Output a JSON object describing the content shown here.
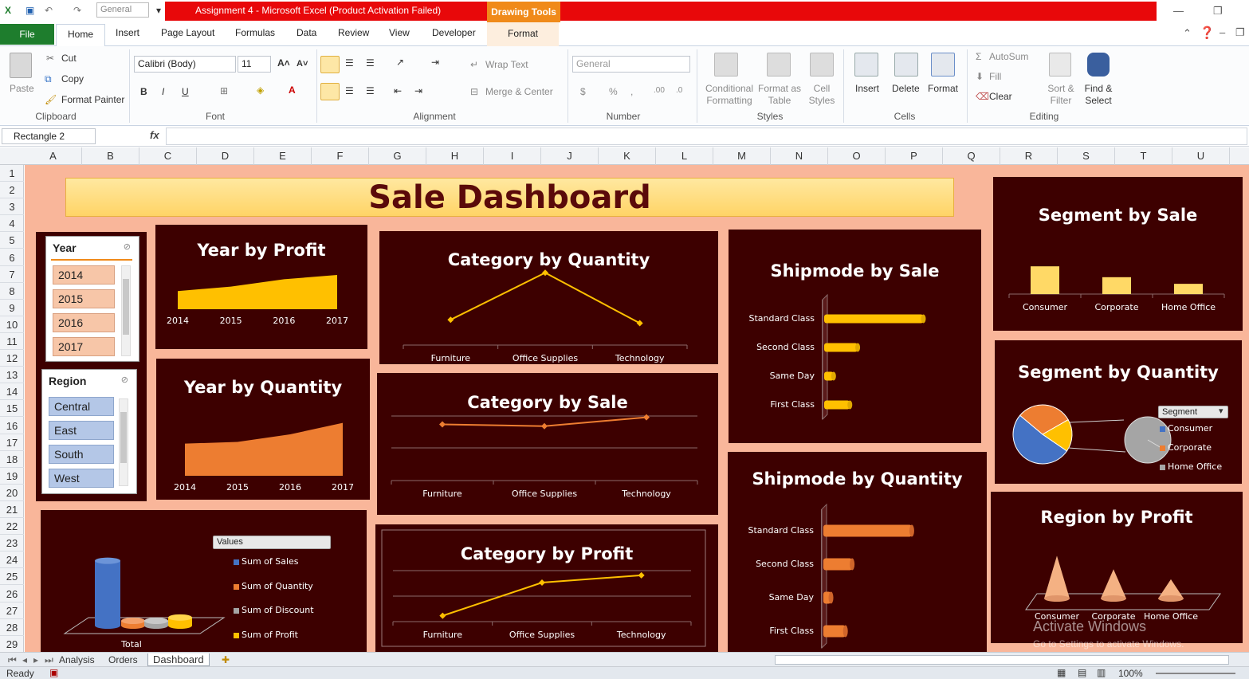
{
  "window": {
    "title": "Assignment 4 - Microsoft Excel (Product Activation Failed)",
    "contextual_tab": "Drawing Tools",
    "qat_combo": "General"
  },
  "tabs": [
    "Home",
    "Insert",
    "Page Layout",
    "Formulas",
    "Data",
    "Review",
    "View",
    "Developer",
    "Format"
  ],
  "file_tab": "File",
  "ribbon": {
    "clipboard": {
      "paste": "Paste",
      "cut": "Cut",
      "copy": "Copy",
      "format_painter": "Format Painter",
      "group": "Clipboard"
    },
    "font": {
      "name": "Calibri (Body)",
      "size": "11",
      "group": "Font"
    },
    "alignment": {
      "wrap": "Wrap Text",
      "merge": "Merge & Center",
      "group": "Alignment"
    },
    "number": {
      "format": "General",
      "group": "Number"
    },
    "styles": {
      "conditional": "Conditional Formatting",
      "format_table": "Format as Table",
      "cell_styles": "Cell Styles",
      "group": "Styles"
    },
    "cells": {
      "insert": "Insert",
      "delete": "Delete",
      "format": "Format",
      "group": "Cells"
    },
    "editing": {
      "autosum": "AutoSum",
      "fill": "Fill",
      "clear": "Clear",
      "sort": "Sort & Filter",
      "find": "Find & Select",
      "group": "Editing"
    }
  },
  "formula_bar": {
    "name_box": "Rectangle 2",
    "fx": "fx",
    "value": ""
  },
  "columns": [
    "A",
    "B",
    "C",
    "D",
    "E",
    "F",
    "G",
    "H",
    "I",
    "J",
    "K",
    "L",
    "M",
    "N",
    "O",
    "P",
    "Q",
    "R",
    "S",
    "T",
    "U"
  ],
  "rows": [
    "1",
    "2",
    "3",
    "4",
    "5",
    "6",
    "7",
    "8",
    "9",
    "10",
    "11",
    "12",
    "13",
    "14",
    "15",
    "16",
    "17",
    "18",
    "19",
    "20",
    "21",
    "22",
    "23",
    "24",
    "25",
    "26",
    "27",
    "28",
    "29"
  ],
  "dashboard": {
    "title": "Sale Dashboard",
    "slicers": {
      "year": {
        "header": "Year",
        "items": [
          "2014",
          "2015",
          "2016",
          "2017"
        ]
      },
      "region": {
        "header": "Region",
        "items": [
          "Central",
          "East",
          "South",
          "West"
        ]
      }
    },
    "values_legend": {
      "header": "Values",
      "items": [
        "Sum of Sales",
        "Sum of Quantity",
        "Sum of Discount",
        "Sum of Profit"
      ],
      "category": "Total"
    },
    "segment_legend": {
      "header": "Segment",
      "items": [
        "Consumer",
        "Corporate",
        "Home Office"
      ]
    }
  },
  "chart_data": [
    {
      "id": "year_by_profit",
      "type": "area",
      "title": "Year by Profit",
      "categories": [
        "2014",
        "2015",
        "2016",
        "2017"
      ],
      "values": [
        49500,
        61600,
        81800,
        93400
      ],
      "ylim": [
        0,
        100000
      ],
      "color": "#ffc000"
    },
    {
      "id": "year_by_quantity",
      "type": "area",
      "title": "Year by Quantity",
      "categories": [
        "2014",
        "2015",
        "2016",
        "2017"
      ],
      "values": [
        7600,
        8000,
        9800,
        12500
      ],
      "ylim": [
        0,
        13000
      ],
      "color": "#ed7d31"
    },
    {
      "id": "category_by_quantity",
      "type": "line",
      "title": "Category by Quantity",
      "categories": [
        "Furniture",
        "Office Supplies",
        "Technology"
      ],
      "values": [
        8028,
        22906,
        6939
      ],
      "ylim": [
        0,
        26000
      ],
      "color": "#ffc000"
    },
    {
      "id": "category_by_sale",
      "type": "line",
      "title": "Category by Sale",
      "categories": [
        "Furniture",
        "Office Supplies",
        "Technology"
      ],
      "values": [
        742000,
        719000,
        836000
      ],
      "ylim": [
        0,
        1000000
      ],
      "color": "#ed7d31"
    },
    {
      "id": "category_by_profit",
      "type": "line",
      "title": "Category by Profit",
      "categories": [
        "Furniture",
        "Office Supplies",
        "Technology"
      ],
      "values": [
        18451,
        122491,
        145455
      ],
      "ylim": [
        0,
        180000
      ],
      "color": "#ffc000"
    },
    {
      "id": "shipmode_by_sale",
      "type": "bar",
      "title": "Shipmode by Sale",
      "categories": [
        "Standard Class",
        "Second Class",
        "Same Day",
        "First Class"
      ],
      "values": [
        1358000,
        459000,
        129000,
        352000
      ],
      "xlim": [
        0,
        1800000
      ],
      "color": "#ffc000"
    },
    {
      "id": "shipmode_by_quantity",
      "type": "bar",
      "title": "Shipmode by Quantity",
      "categories": [
        "Standard Class",
        "Second Class",
        "Same Day",
        "First Class"
      ],
      "values": [
        22797,
        7423,
        1960,
        5693
      ],
      "xlim": [
        0,
        30000
      ],
      "color": "#ed7d31"
    },
    {
      "id": "segment_by_sale",
      "type": "bar",
      "title": "Segment by Sale",
      "categories": [
        "Consumer",
        "Corporate",
        "Home Office"
      ],
      "values": [
        1161000,
        706000,
        429000
      ],
      "ylim": [
        0,
        1400000
      ],
      "color": "#ffd966"
    },
    {
      "id": "segment_by_quantity",
      "type": "pie",
      "title": "Segment by Quantity",
      "categories": [
        "Consumer",
        "Corporate",
        "Home Office"
      ],
      "values": [
        19521,
        11608,
        6744
      ],
      "colors": [
        "#4472c4",
        "#ed7d31",
        "#ffc000"
      ]
    },
    {
      "id": "region_by_profit",
      "type": "bar",
      "title": "Region by Profit",
      "categories": [
        "Consumer",
        "Corporate",
        "Home Office"
      ],
      "values": [
        134119,
        91979,
        60299
      ],
      "ylim": [
        0,
        150000
      ],
      "color": "#f4b183"
    },
    {
      "id": "values_total",
      "type": "bar",
      "title": "",
      "categories": [
        "Total"
      ],
      "series": [
        {
          "name": "Sum of Sales",
          "values": [
            2297201
          ]
        },
        {
          "name": "Sum of Quantity",
          "values": [
            37873
          ]
        },
        {
          "name": "Sum of Discount",
          "values": [
            1561
          ]
        },
        {
          "name": "Sum of Profit",
          "values": [
            286397
          ]
        }
      ],
      "ylim": [
        0,
        2400000
      ],
      "colors": [
        "#4472c4",
        "#ed7d31",
        "#a5a5a5",
        "#ffc000"
      ]
    }
  ],
  "sheet_tabs": [
    "Analysis",
    "Orders",
    "Dashboard"
  ],
  "active_sheet": "Dashboard",
  "status": {
    "ready": "Ready",
    "zoom": "100%"
  },
  "watermark": {
    "line1": "Activate Windows",
    "line2": "Go to Settings to activate Windows."
  }
}
